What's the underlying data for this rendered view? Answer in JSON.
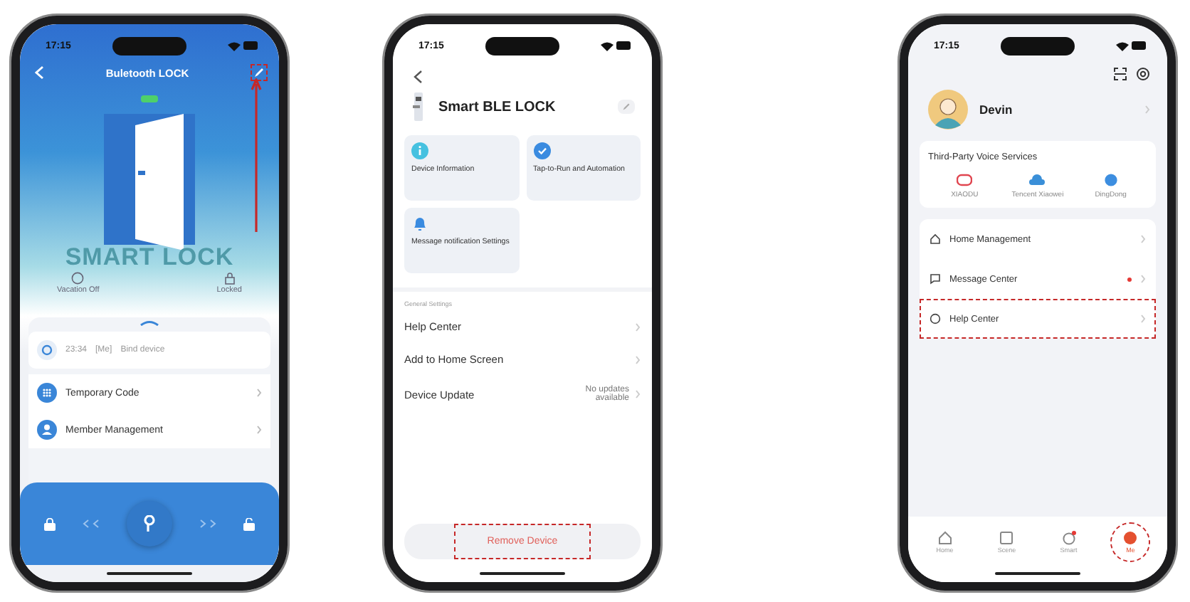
{
  "lock_screen": {
    "time": "17:15",
    "title": "Buletooth LOCK",
    "edit_highlighted": true,
    "brand": "SMART LOCK",
    "statuses": [
      {
        "kind": "vacation",
        "label": "Vacation Off"
      },
      {
        "kind": "lock",
        "label": "Locked"
      }
    ],
    "log": {
      "time": "23:34",
      "user": "[Me]",
      "event": "Bind device"
    },
    "menu": [
      {
        "kind": "grid",
        "label": "Temporary Code"
      },
      {
        "kind": "person",
        "label": "Member Management"
      }
    ]
  },
  "settings_screen": {
    "time": "17:15",
    "device_name": "Smart BLE LOCK",
    "tiles": [
      {
        "kind": "info",
        "label": "Device Information"
      },
      {
        "kind": "check",
        "label": "Tap-to-Run and Automation"
      },
      {
        "kind": "bell",
        "label": "Message notification Settings"
      }
    ],
    "section": "General Settings",
    "rows": [
      {
        "label": "Help Center"
      },
      {
        "label": "Add to Home Screen"
      },
      {
        "label": "Device Update",
        "value": "No updates available"
      }
    ],
    "remove": {
      "label": "Remove Device",
      "highlighted": true
    }
  },
  "profile_screen": {
    "time": "17:15",
    "user": "Devin",
    "voice_title": "Third-Party Voice Services",
    "voice": [
      {
        "kind": "robot",
        "label": "XIAODU",
        "color": "#e0454f"
      },
      {
        "kind": "cloud",
        "label": "Tencent Xiaowei",
        "color": "#3a8fd8"
      },
      {
        "kind": "globe",
        "label": "DingDong",
        "color": "#3d8ee0"
      }
    ],
    "menu": [
      {
        "kind": "home",
        "label": "Home Management",
        "dot": false,
        "highlighted": false
      },
      {
        "kind": "message",
        "label": "Message Center",
        "dot": true,
        "highlighted": false
      },
      {
        "kind": "help",
        "label": "Help Center",
        "dot": false,
        "highlighted": true
      }
    ],
    "tabs": [
      {
        "kind": "home",
        "label": "Home",
        "selected": false,
        "highlighted": false,
        "badge": false
      },
      {
        "kind": "scene",
        "label": "Scene",
        "selected": false,
        "highlighted": false,
        "badge": false
      },
      {
        "kind": "smart",
        "label": "Smart",
        "selected": false,
        "highlighted": false,
        "badge": true
      },
      {
        "kind": "me",
        "label": "Me",
        "selected": true,
        "highlighted": true,
        "badge": false
      }
    ]
  }
}
